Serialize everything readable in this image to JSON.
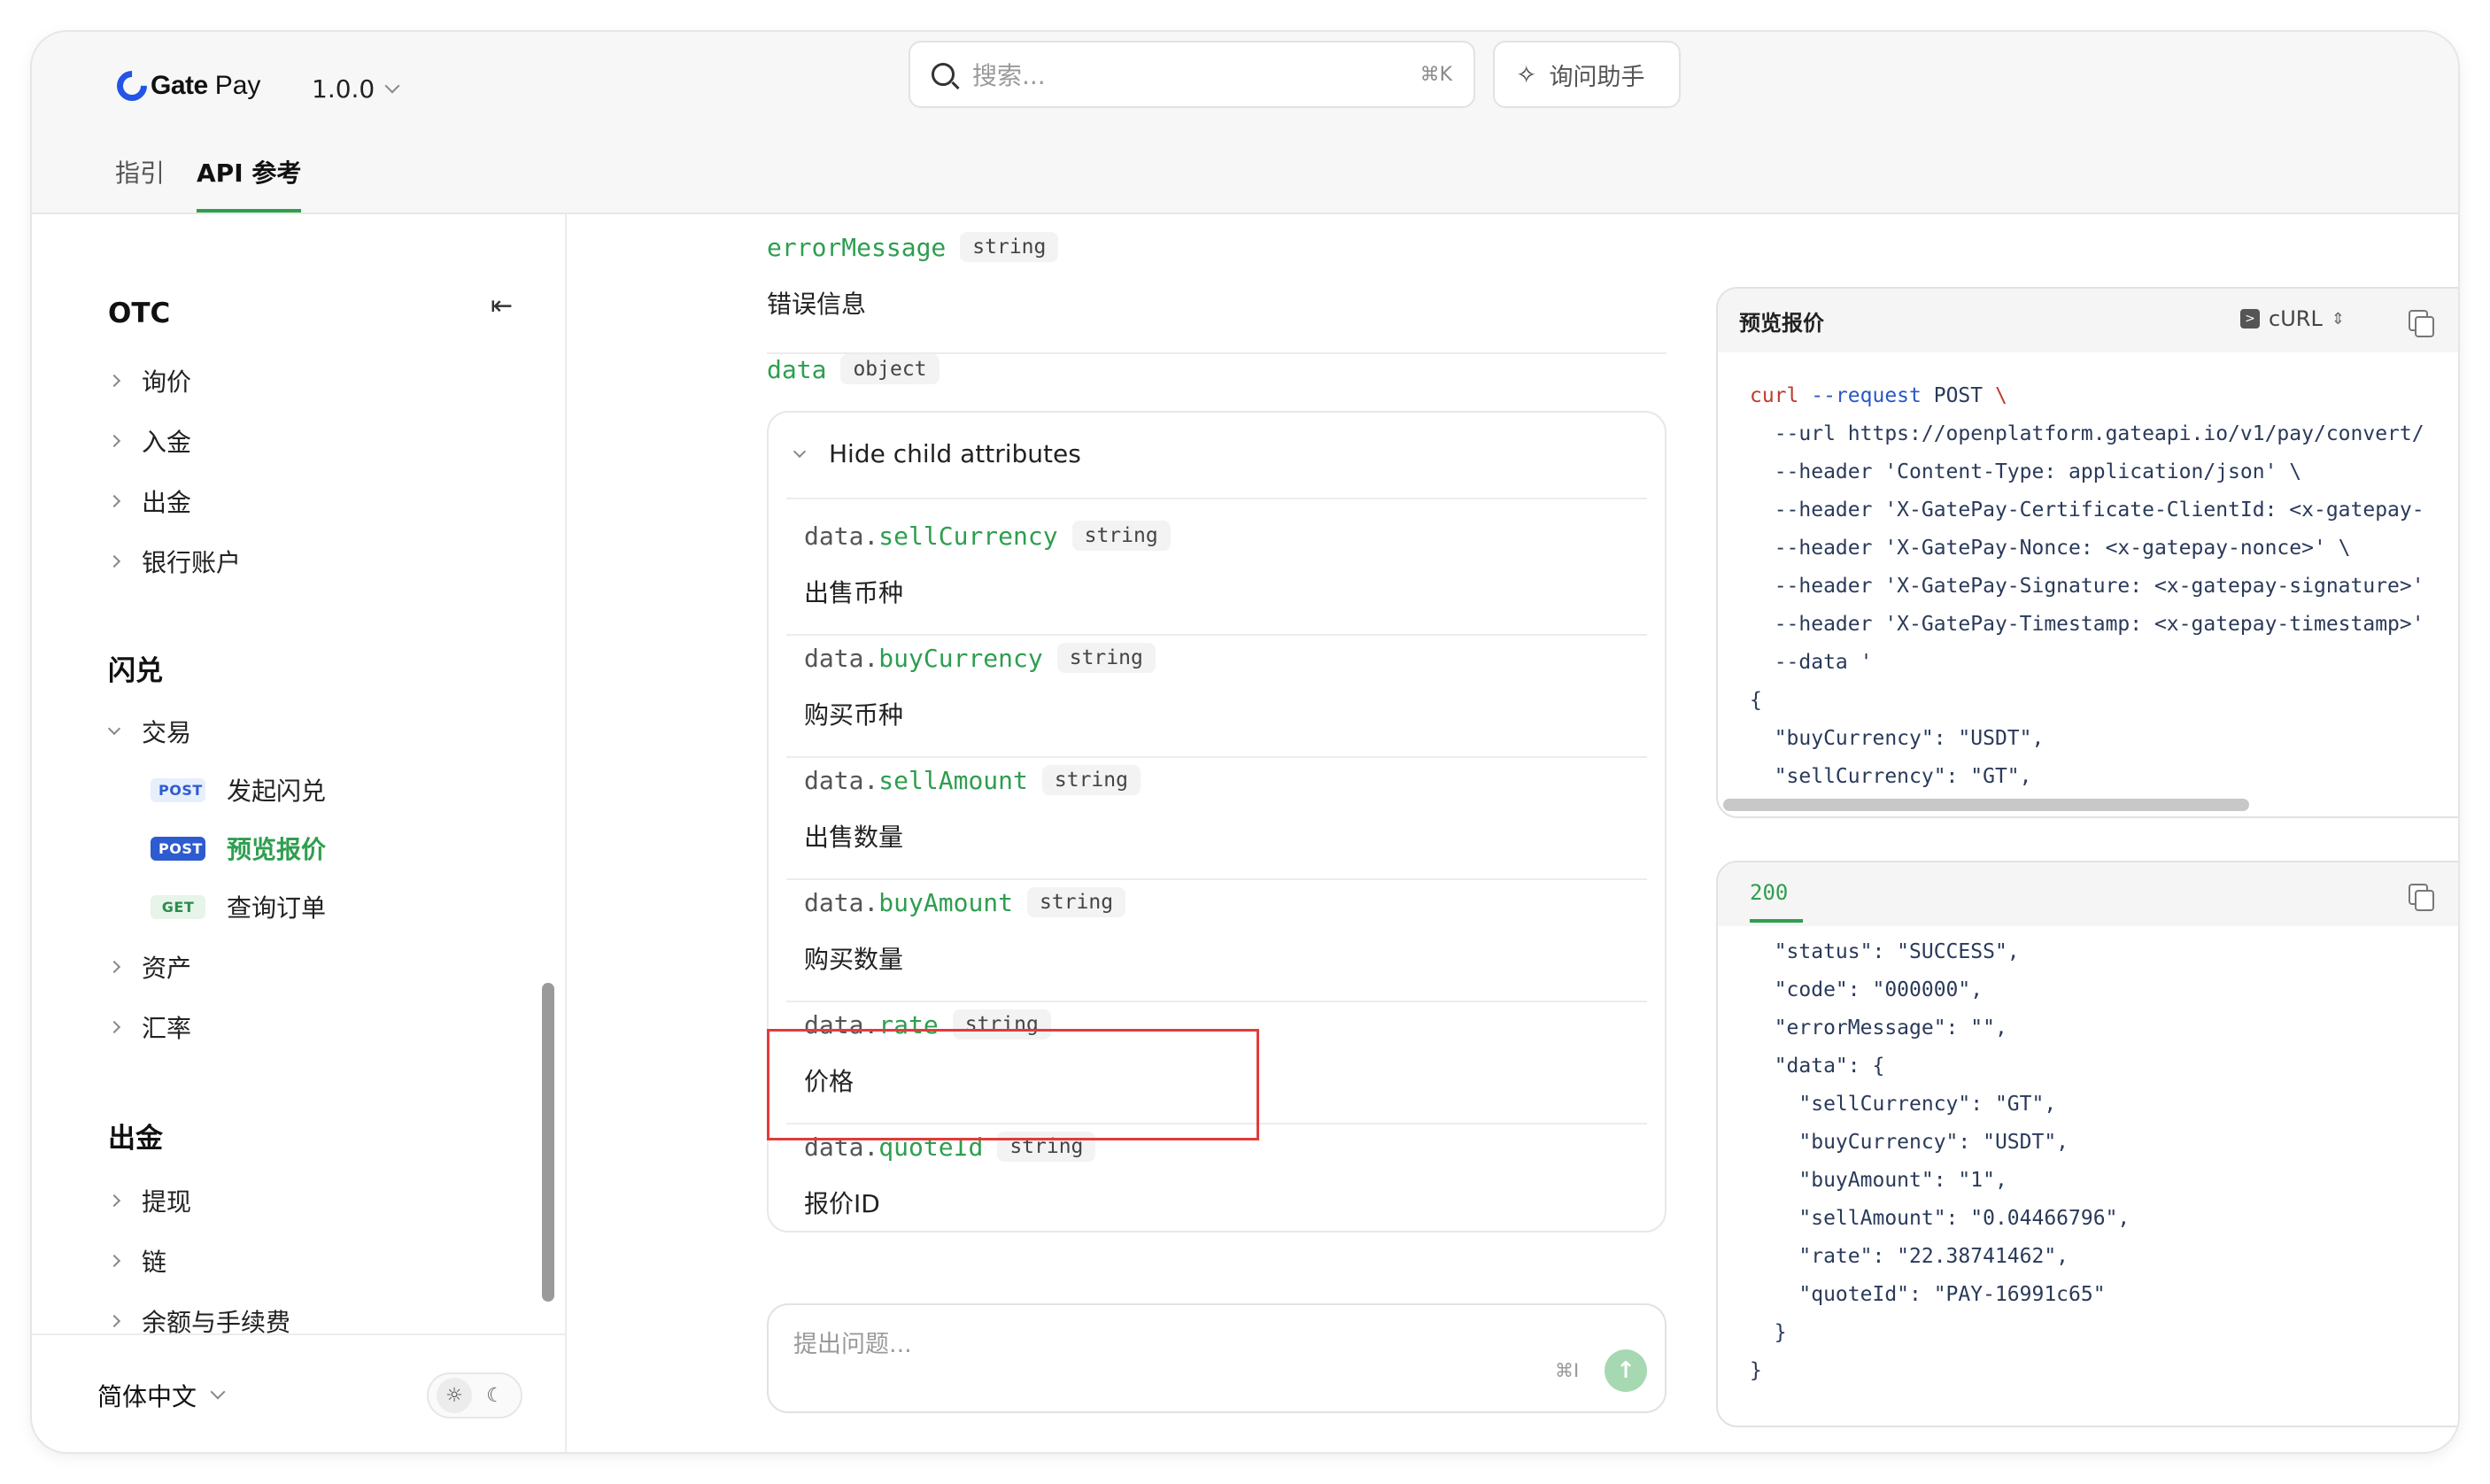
{
  "header": {
    "brand": "Gate",
    "brand_suffix": "Pay",
    "version": "1.0.0",
    "search_placeholder": "搜索...",
    "search_shortcut": "⌘K",
    "assistant_label": "询问助手",
    "tabs": [
      {
        "label": "指引",
        "active": false
      },
      {
        "label": "API 参考",
        "active": true
      }
    ]
  },
  "sidebar": {
    "sections": [
      {
        "title": "OTC",
        "items": [
          "询价",
          "入金",
          "出金",
          "银行账户"
        ]
      },
      {
        "title": "闪兑",
        "items": [
          "交易",
          "资产",
          "汇率"
        ],
        "endpoints": [
          {
            "method": "POST",
            "label": "发起闪兑",
            "active": false
          },
          {
            "method": "POST",
            "label": "预览报价",
            "active": true
          },
          {
            "method": "GET",
            "label": "查询订单",
            "active": false
          }
        ]
      },
      {
        "title": "出金",
        "items": [
          "提现",
          "链",
          "余额与手续费"
        ]
      }
    ],
    "language": "简体中文"
  },
  "main": {
    "fields": [
      {
        "name": "errorMessage",
        "type": "string",
        "desc": "错误信息"
      },
      {
        "name": "data",
        "type": "object"
      }
    ],
    "child_toggle": "Hide child attributes",
    "child_prefix": "data.",
    "child_fields": [
      {
        "name": "sellCurrency",
        "type": "string",
        "desc": "出售币种"
      },
      {
        "name": "buyCurrency",
        "type": "string",
        "desc": "购买币种"
      },
      {
        "name": "sellAmount",
        "type": "string",
        "desc": "出售数量"
      },
      {
        "name": "buyAmount",
        "type": "string",
        "desc": "购买数量"
      },
      {
        "name": "rate",
        "type": "string",
        "desc": "价格"
      },
      {
        "name": "quoteId",
        "type": "string",
        "desc": "报价ID"
      }
    ],
    "ask_placeholder": "提出问题...",
    "ask_shortcut": "⌘I"
  },
  "request_panel": {
    "title": "预览报价",
    "language": "cURL",
    "lines": [
      "curl --request POST \\",
      "  --url https://openplatform.gateapi.io/v1/pay/convert/",
      "  --header 'Content-Type: application/json' \\",
      "  --header 'X-GatePay-Certificate-ClientId: <x-gatepay-",
      "  --header 'X-GatePay-Nonce: <x-gatepay-nonce>' \\",
      "  --header 'X-GatePay-Signature: <x-gatepay-signature>'",
      "  --header 'X-GatePay-Timestamp: <x-gatepay-timestamp>'",
      "  --data '",
      "{",
      "  \"buyCurrency\": \"USDT\",",
      "  \"sellCurrency\": \"GT\","
    ]
  },
  "response_panel": {
    "status_tab": "200",
    "lines": [
      "  \"status\": \"SUCCESS\",",
      "  \"code\": \"000000\",",
      "  \"errorMessage\": \"\",",
      "  \"data\": {",
      "    \"sellCurrency\": \"GT\",",
      "    \"buyCurrency\": \"USDT\",",
      "    \"buyAmount\": \"1\",",
      "    \"sellAmount\": \"0.04466796\",",
      "    \"rate\": \"22.38741462\",",
      "    \"quoteId\": \"PAY-16991c65\"",
      "  }",
      "}"
    ]
  }
}
